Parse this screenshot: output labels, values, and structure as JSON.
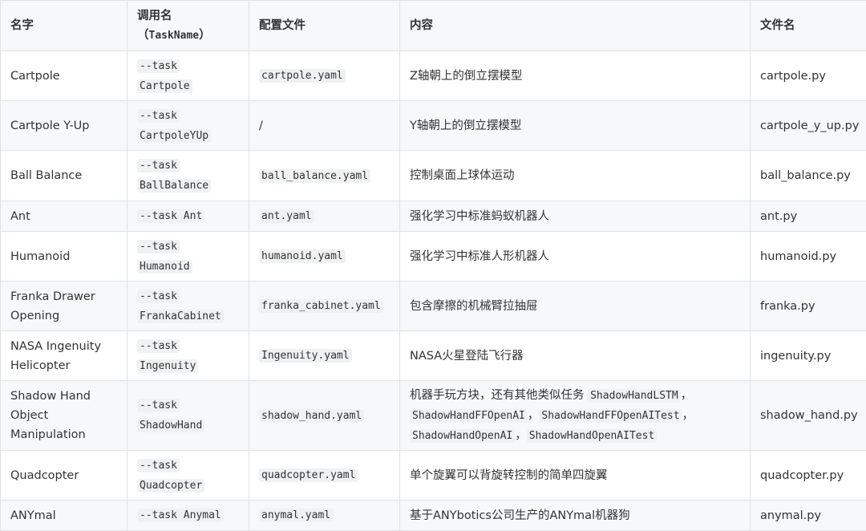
{
  "header": {
    "col_name": "名字",
    "col_call_line1": "调用名",
    "col_call_line2": "（TaskName）",
    "col_call_code": "TaskName",
    "col_call_open": "（",
    "col_call_close": "）",
    "col_config": "配置文件",
    "col_content": "内容",
    "col_filename": "文件名"
  },
  "rows": [
    {
      "name": "Cartpole",
      "task_prefix": "--task",
      "task_name": "Cartpole",
      "config": "cartpole.yaml",
      "content": "Z轴朝上的倒立摆模型",
      "file": "cartpole.py"
    },
    {
      "name": "Cartpole Y-Up",
      "task_prefix": "--task",
      "task_name": "CartpoleYUp",
      "config": "/",
      "content": "Y轴朝上的倒立摆模型",
      "file": "cartpole_y_up.py"
    },
    {
      "name": "Ball Balance",
      "task_prefix": "--task",
      "task_name": "BallBalance",
      "config": "ball_balance.yaml",
      "content": "控制桌面上球体运动",
      "file": "ball_balance.py"
    },
    {
      "name": "Ant",
      "task_full": "--task Ant",
      "config": "ant.yaml",
      "content": "强化学习中标准蚂蚁机器人",
      "file": "ant.py"
    },
    {
      "name": "Humanoid",
      "task_prefix": "--task",
      "task_name": "Humanoid",
      "config": "humanoid.yaml",
      "content": "强化学习中标准人形机器人",
      "file": "humanoid.py"
    },
    {
      "name_line1": "Franka Drawer",
      "name_line2": "Opening",
      "task_prefix": "--task",
      "task_name": "FrankaCabinet",
      "config": "franka_cabinet.yaml",
      "content": "包含摩擦的机械臂拉抽屉",
      "file": "franka.py"
    },
    {
      "name_line1": "NASA Ingenuity",
      "name_line2": "Helicopter",
      "task_prefix": "--task",
      "task_name": "Ingenuity",
      "config": "Ingenuity.yaml",
      "content": "NASA火星登陆飞行器",
      "file": "ingenuity.py"
    },
    {
      "name_line1": "Shadow Hand",
      "name_line2": "Object",
      "name_line3": "Manipulation",
      "task_prefix": "--task",
      "task_name": "ShadowHand",
      "config": "shadow_hand.yaml",
      "content_text": "机器手玩方块，还有其他类似任务 ",
      "content_code1": "ShadowHandLSTM",
      "sep1": "，",
      "content_code2": "ShadowHandFFOpenAI",
      "sep2": "，",
      "content_code3": "ShadowHandFFOpenAITest",
      "sep3": "，",
      "content_code4": "ShadowHandOpenAI",
      "sep4": "，",
      "content_code5": "ShadowHandOpenAITest",
      "file": "shadow_hand.py"
    },
    {
      "name": "Quadcopter",
      "task_prefix": "--task",
      "task_name": "Quadcopter",
      "config": "quadcopter.yaml",
      "content": "单个旋翼可以背旋转控制的简单四旋翼",
      "file": "quadcopter.py"
    },
    {
      "name": "ANYmal",
      "task_full": "--task Anymal",
      "config": "anymal.yaml",
      "content": "基于ANYbotics公司生产的ANYmal机器狗",
      "file": "anymal.py"
    }
  ]
}
